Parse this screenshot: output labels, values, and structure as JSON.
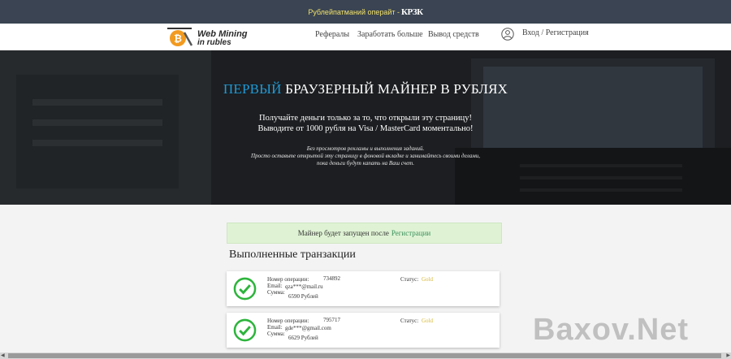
{
  "topbar": {
    "text": "Рублейпатманий операйт -",
    "number": "КРЗК"
  },
  "nav": {
    "logo_line1": "Web Mining",
    "logo_line2": "in rubles",
    "links": [
      "Рефералы",
      "Заработать больше",
      "Вывод средств"
    ],
    "login": "Вход / Регистрация"
  },
  "hero": {
    "title_accent": "ПЕРВЫЙ",
    "title_rest": "БРАУЗЕРНЫЙ МАЙНЕР В РУБЛЯХ",
    "line1": "Получайте деньги только за то, что открыли эту страницу!",
    "line2": "Выводите от 1000 рубля на Visa / MasterCard моментально!",
    "small1": "Без просмотров рекламы и выполнения заданий.",
    "small2": "Просто оставьте открытой эту страницу в фоновой вкладке и занимайтесь своими делами,",
    "small3": "пока деньги будут капать на Ваш счет."
  },
  "notice": {
    "text": "Майнер будет запущен после",
    "link": "Регистрации"
  },
  "transactions": {
    "title": "Выполненные транзакции",
    "labels": {
      "op": "Номер операции:",
      "email": "Email:",
      "sum": "Сумма:",
      "status": "Статус:"
    },
    "items": [
      {
        "op": "734892",
        "email": "qza***@mail.ru",
        "sum": "6590 Рублей",
        "status": "Gold"
      },
      {
        "op": "795717",
        "email": "gde***@gmail.com",
        "sum": "6629 Рублей",
        "status": "Gold"
      }
    ]
  },
  "watermark": "Baxov.Net",
  "colors": {
    "accent": "#1e9ad6",
    "topbar": "#3a4452",
    "check": "#2db43c",
    "gold": "#d8b93a"
  }
}
